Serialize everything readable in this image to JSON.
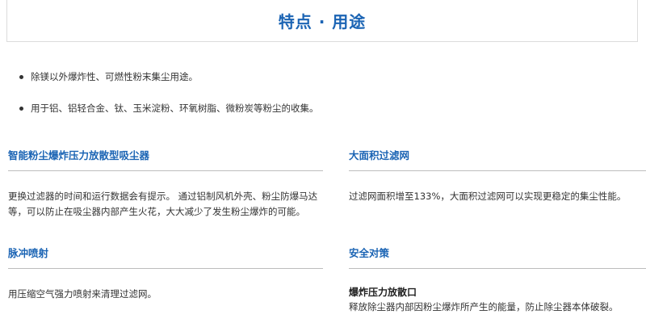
{
  "header": {
    "title": "特点 · 用途"
  },
  "uses": [
    "除镁以外爆炸性、可燃性粉末集尘用途。",
    "用于铝、铝轻合金、钛、玉米淀粉、环氧树脂、微粉炭等粉尘的收集。"
  ],
  "features": {
    "smart": {
      "title": "智能粉尘爆炸压力放散型吸尘器",
      "text": "更换过滤器的时间和运行数据会有提示。 通过铝制风机外壳、粉尘防爆马达等，可以防止在吸尘器内部产生火花，大大减少了发生粉尘爆炸的可能。"
    },
    "filter": {
      "title": "大面积过滤网",
      "text": "过滤网面积增至133%，大面积过滤网可以实现更稳定的集尘性能。"
    },
    "pulse": {
      "title": "脉冲喷射",
      "text": "用压缩空气强力喷射来清理过滤网。"
    },
    "safety": {
      "title": "安全对策",
      "sub_title": "爆炸压力放散口",
      "text": "释放除尘器内部因粉尘爆炸所产生的能量，防止除尘器本体破裂。"
    }
  }
}
